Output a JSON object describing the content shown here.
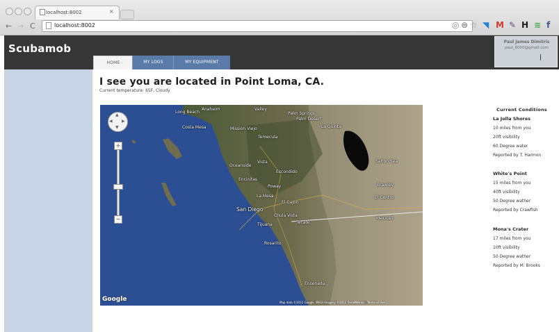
{
  "browser": {
    "tab_title": "localhost:8002",
    "tab_close": "×",
    "url": "localhost:8002",
    "nav": {
      "back": "←",
      "forward": "→",
      "reload": "C"
    },
    "extensions": [
      {
        "icon": "location-icon",
        "glyph": "◎",
        "color": "#8a8a8a"
      },
      {
        "icon": "rss-icon",
        "glyph": "⊜",
        "color": "#8a8a8a"
      },
      {
        "icon": "star-icon",
        "glyph": "☆",
        "color": "#8a8a8a"
      },
      {
        "icon": "extension-icon",
        "glyph": "◥",
        "color": "#2a7fd5"
      },
      {
        "icon": "gmail-icon",
        "glyph": "M",
        "color": "#d43a2c"
      },
      {
        "icon": "pencil-icon",
        "glyph": "✎",
        "color": "#6a4a8a"
      },
      {
        "icon": "h-icon",
        "glyph": "H",
        "color": "#1a1a1a"
      },
      {
        "icon": "wifi-icon",
        "glyph": "≋",
        "color": "#4aa84a"
      },
      {
        "icon": "facebook-icon",
        "glyph": "f",
        "color": "#3b5a98"
      }
    ]
  },
  "site": {
    "logo": "Scubamob",
    "user": {
      "name": "Paul James Dimitris",
      "email": "paul_8000@gmail.com"
    },
    "nav_tabs": [
      "HOME",
      "MY LOGS",
      "MY EQUIPMENT"
    ],
    "active_tab": "HOME"
  },
  "main": {
    "headline": "I see you are located in Point Loma, CA.",
    "temperature": "Current temperature: 65F, Cloudy"
  },
  "map": {
    "provider": "Google",
    "attribution": "Map data ©2012 Google, INEGI Imagery ©2012 TerraMetrics - Terms of Use",
    "labels": [
      "Long Beach",
      "Anaheim",
      "Valley",
      "Palm Desert",
      "Palm Springs",
      "La Quinta",
      "Costa Mesa",
      "Mission Viejo",
      "Temecula",
      "Oceanside",
      "Vista",
      "Escondido",
      "Encinitas",
      "Poway",
      "La Mesa",
      "El Cajon",
      "San Diego",
      "Chula Vista",
      "Tijuana",
      "Tecate",
      "Mexicali",
      "El Centro",
      "Brawley",
      "Salton Sea",
      "Rosarito",
      "Ensenada"
    ]
  },
  "conditions": {
    "title": "Current Conditions",
    "sites": [
      {
        "name": "La Jolla Shores",
        "distance": "10 miles from you",
        "visibility": "20ft visibility",
        "temp": "60 Degree water",
        "reporter": "Reported by T. Harmon"
      },
      {
        "name": "White's Point",
        "distance": "15 miles from you",
        "visibility": "40ft visibility",
        "temp": "50 Degree wather",
        "reporter": "Reported by Crawfish"
      },
      {
        "name": "Mona's Crater",
        "distance": "17 miles from you",
        "visibility": "10ft visibility",
        "temp": "50 Degree wather",
        "reporter": "Reported by M. Brooks"
      }
    ]
  }
}
